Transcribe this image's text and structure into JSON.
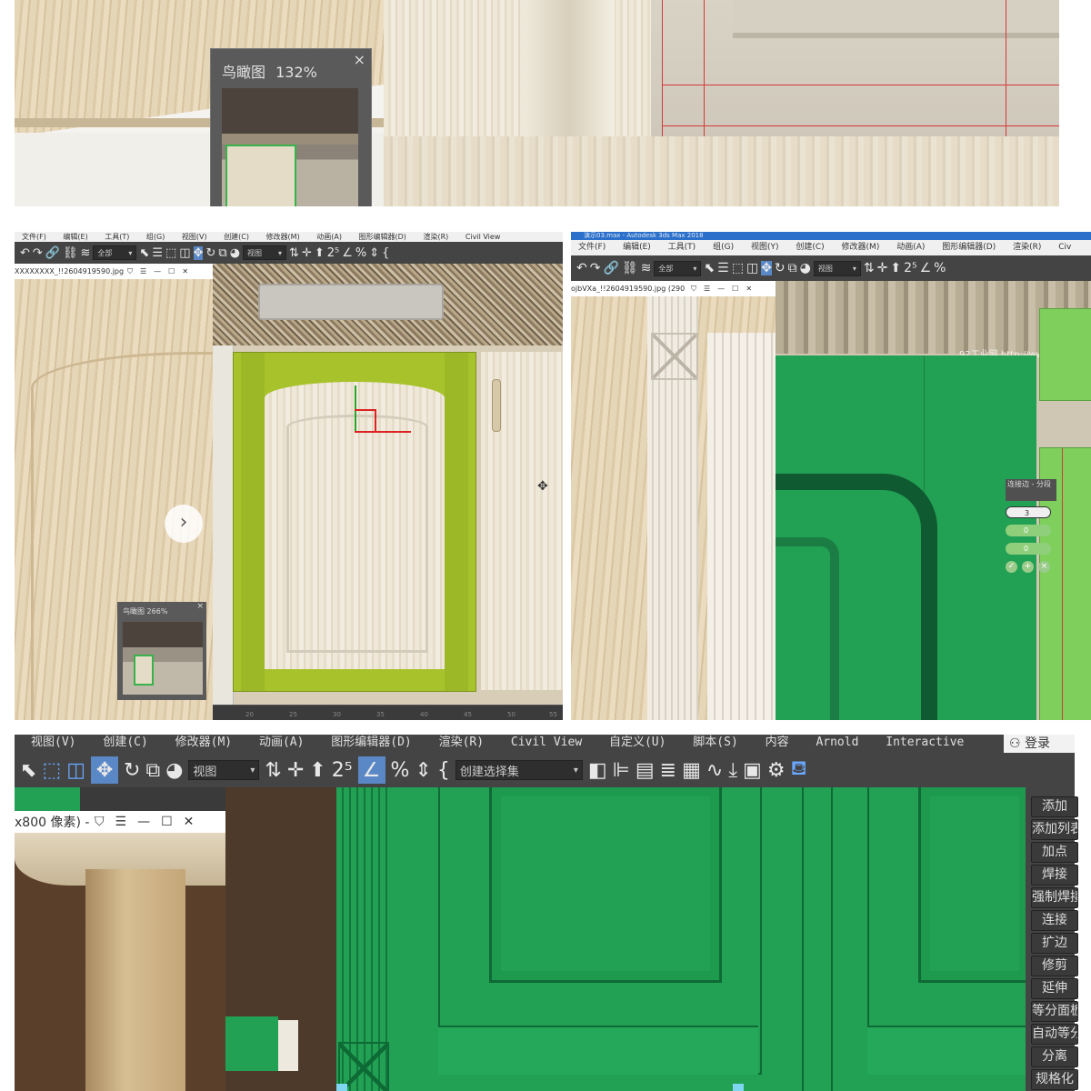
{
  "panel1": {
    "birdseye_label": "鸟瞰图",
    "birdseye_zoom": "132%",
    "close_icon": "close-icon"
  },
  "panel2": {
    "menu": [
      "文件(F)",
      "编辑(E)",
      "工具(T)",
      "组(G)",
      "视图(V)",
      "创建(C)",
      "修改器(M)",
      "动画(A)",
      "图形编辑器(D)",
      "渲染(R)",
      "Civil View"
    ],
    "filter_value": "全部",
    "refcoord_value": "视图",
    "viewer_filename": "XXXXXXXX_!!2604919590.jpg (5",
    "birdseye_label": "鸟瞰图",
    "birdseye_zoom": "266%",
    "ruler_ticks": [
      "20",
      "25",
      "30",
      "35",
      "40",
      "45",
      "50",
      "55"
    ],
    "highlight_color": "#a8c22b"
  },
  "panel3": {
    "title": "演示03.max - Autodesk 3ds Max 2018",
    "menu": [
      "文件(F)",
      "编辑(E)",
      "工具(T)",
      "组(G)",
      "视图(Y)",
      "创建(C)",
      "修改器(M)",
      "动画(A)",
      "图形编辑器(D)",
      "渲染(R)",
      "Civ"
    ],
    "filter_value": "全部",
    "refcoord_value": "视图",
    "viewer_filename": "ojbVXa_!!2604919590.jpg (290",
    "watermark": "92工业网 http://www.92gyw",
    "caddy_title": "连接边 - 分段",
    "caddy_values": [
      "3",
      "0",
      "0"
    ],
    "highlight_color": "#22a155"
  },
  "panel4": {
    "menu": [
      "视图(V)",
      "创建(C)",
      "修改器(M)",
      "动画(A)",
      "图形编辑器(D)",
      "渲染(R)",
      "Civil View",
      "自定义(U)",
      "脚本(S)",
      "内容",
      "Arnold",
      "Interactive"
    ],
    "login_label": "登录",
    "refcoord_value": "视图",
    "selection_set_placeholder": "创建选择集",
    "viewer_filename": "x800 像素) -",
    "command_buttons": [
      "添加",
      "添加列表",
      "加点",
      "焊接",
      "强制焊接",
      "连接",
      "扩边",
      "修剪",
      "延伸",
      "等分面板",
      "自动等分",
      "分离",
      "规格化"
    ],
    "highlight_color": "#22a155"
  }
}
